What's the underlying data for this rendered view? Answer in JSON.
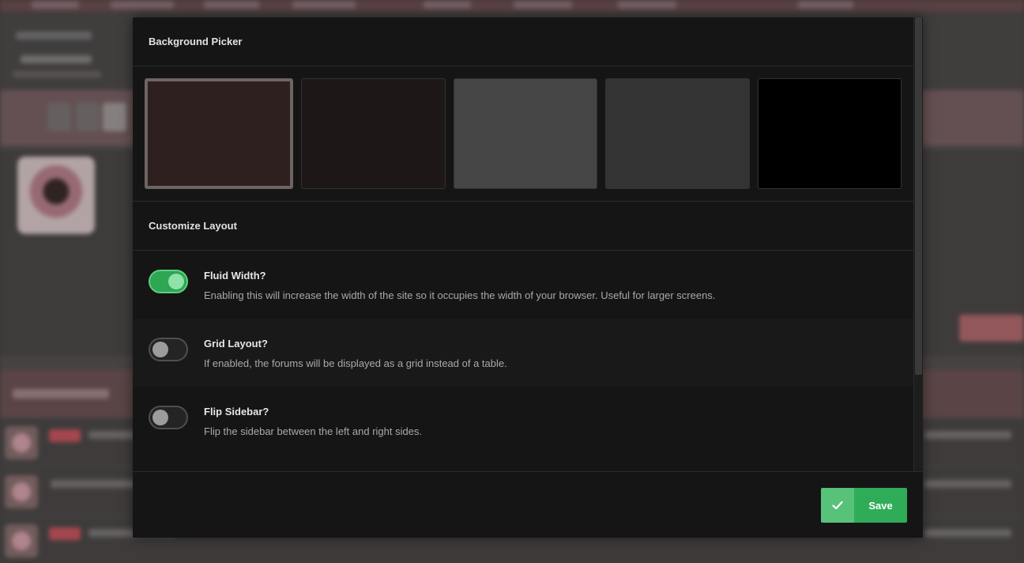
{
  "modal": {
    "background_picker_title": "Background Picker",
    "swatches": [
      {
        "color": "#2e201f",
        "selected": true
      },
      {
        "color": "#1e1717",
        "selected": false
      },
      {
        "color": "#454545",
        "selected": false
      },
      {
        "color": "#333333",
        "selected": false
      },
      {
        "color": "#000000",
        "selected": false
      }
    ],
    "customize_title": "Customize Layout",
    "options": [
      {
        "title": "Fluid Width?",
        "description": "Enabling this will increase the width of the site so it occupies the width of your browser. Useful for larger screens.",
        "enabled": true
      },
      {
        "title": "Grid Layout?",
        "description": "If enabled, the forums will be displayed as a grid instead of a table.",
        "enabled": false
      },
      {
        "title": "Flip Sidebar?",
        "description": "Flip the sidebar between the left and right sides.",
        "enabled": false
      }
    ],
    "save_label": "Save",
    "save_icon": "check-icon"
  },
  "colors": {
    "accent_green": "#2fac58",
    "toggle_on": "#2ea653"
  }
}
